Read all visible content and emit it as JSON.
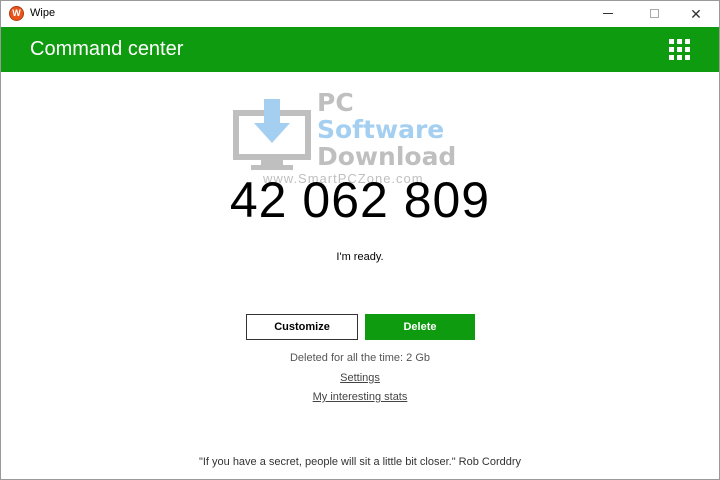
{
  "window": {
    "title": "Wipe",
    "app_icon_letter": "W",
    "icons": {
      "app": "wipe-app-icon",
      "minimize": "minimize-icon",
      "maximize": "maximize-icon",
      "close": "close-icon"
    },
    "close_glyph": "✕"
  },
  "header": {
    "title": "Command center",
    "menu_icon": "grid-menu-icon",
    "color": "#0f9b0f"
  },
  "watermark": {
    "line1": "PC",
    "line2": "Software",
    "line3": "Download",
    "url": "www.SmartPCZone.com",
    "icon": "monitor-download-icon"
  },
  "main": {
    "counter": "42 062 809",
    "status": "I'm ready.",
    "customize_label": "Customize",
    "delete_label": "Delete",
    "deleted_total": "Deleted for all the time: 2 Gb",
    "settings_link": "Settings",
    "stats_link": "My interesting stats"
  },
  "footer": {
    "quote": "\"If you have a secret, people will sit a little bit closer.\" Rob Corddry"
  },
  "colors": {
    "accent": "#0f9b0f",
    "watermark_blue": "#5aa9e6",
    "watermark_gray": "#8c8c8c"
  }
}
